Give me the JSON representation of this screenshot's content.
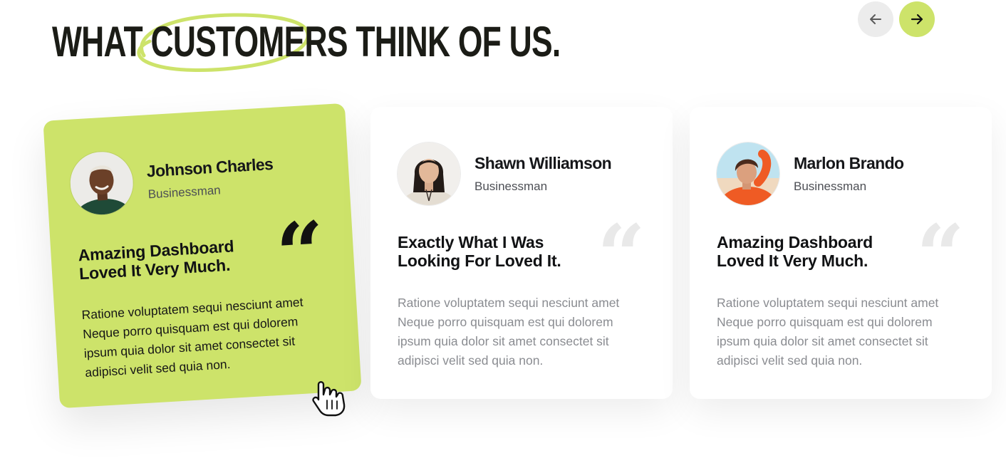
{
  "heading": {
    "before": "WHAT ",
    "highlight": "CUSTOMERS",
    "after": " THINK OF US."
  },
  "nav": {
    "prev_icon": "arrow-left-icon",
    "next_icon": "arrow-right-icon"
  },
  "colors": {
    "accent": "#cde36a",
    "heading": "#1b1c16",
    "muted_text": "#8a8c91",
    "quote_inactive": "#e9e9e9"
  },
  "testimonials": [
    {
      "name": "Johnson Charles",
      "role": "Businessman",
      "title": "Amazing Dashboard Loved It Very Much.",
      "body": "Ratione voluptatem sequi nesciunt amet Neque porro quisquam est qui dolorem ipsum quia dolor sit amet consectet sit adipisci velit sed quia non.",
      "quote": "“",
      "active": true
    },
    {
      "name": "Shawn Williamson",
      "role": "Businessman",
      "title": "Exactly What I Was Looking For Loved It.",
      "body": "Ratione voluptatem sequi nesciunt amet Neque porro quisquam est qui dolorem ipsum quia dolor sit amet consectet sit adipisci velit sed quia non.",
      "quote": "“",
      "active": false
    },
    {
      "name": "Marlon Brando",
      "role": "Businessman",
      "title": "Amazing Dashboard Loved It Very Much.",
      "body": "Ratione voluptatem sequi nesciunt amet Neque porro quisquam est qui dolorem ipsum quia dolor sit amet consectet sit adipisci velit sed quia non.",
      "quote": "“",
      "active": false
    }
  ]
}
